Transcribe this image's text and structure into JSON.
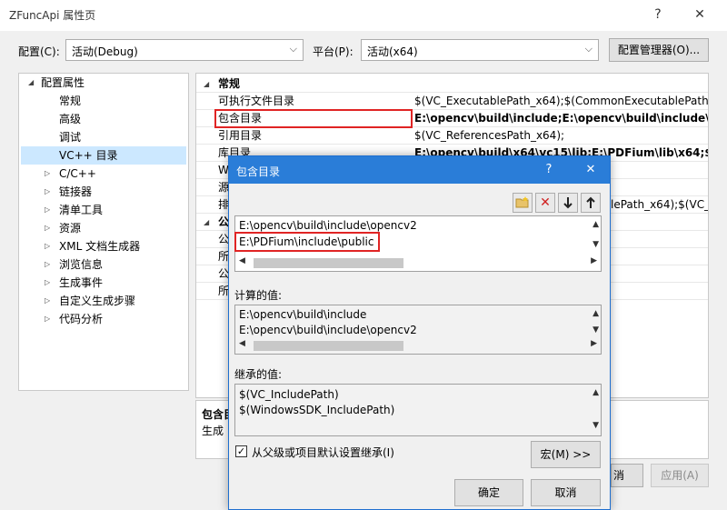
{
  "window": {
    "title": "ZFuncApi 属性页",
    "help": "?",
    "close": "✕"
  },
  "config_label": "配置(C):",
  "config_value": "活动(Debug)",
  "platform_label": "平台(P):",
  "platform_value": "活动(x64)",
  "config_manager_button": "配置管理器(O)...",
  "tree": {
    "root": "配置属性",
    "children": [
      "常规",
      "高级",
      "调试",
      "VC++ 目录"
    ],
    "collapsed": [
      "C/C++",
      "链接器",
      "清单工具",
      "资源",
      "XML 文档生成器",
      "浏览信息",
      "生成事件",
      "自定义生成步骤",
      "代码分析"
    ]
  },
  "grid": {
    "section_general": "常规",
    "rows": [
      {
        "name": "可执行文件目录",
        "value": "$(VC_ExecutablePath_x64);$(CommonExecutablePath)"
      },
      {
        "name": "包含目录",
        "value": "E:\\opencv\\build\\include;E:\\opencv\\build\\include\\ope"
      },
      {
        "name": "引用目录",
        "value": "$(VC_ReferencesPath_x64);"
      },
      {
        "name": "库目录",
        "value": "E:\\opencv\\build\\x64\\vc15\\lib;E:\\PDFium\\lib\\x64;$(Lil"
      },
      {
        "name": "W",
        "value": ""
      },
      {
        "name": "源",
        "value": ""
      },
      {
        "name": "排",
        "value": "lePath_x64);$(VC_I"
      }
    ],
    "section_public": "公",
    "public_rows": [
      "公",
      "所",
      "公",
      "所"
    ]
  },
  "description": {
    "title": "包含目",
    "text": "生成"
  },
  "buttons": {
    "cancel_partial": "消",
    "apply": "应用(A)"
  },
  "dialog": {
    "title": "包含目录",
    "help": "?",
    "close": "✕",
    "toolbar": [
      "new-folder",
      "delete",
      "move-down",
      "move-up"
    ],
    "entries": [
      "E:\\opencv\\build\\include\\opencv2",
      "E:\\PDFium\\include\\public"
    ],
    "computed_label": "计算的值:",
    "computed": [
      "E:\\opencv\\build\\include",
      "E:\\opencv\\build\\include\\opencv2"
    ],
    "inherited_label": "继承的值:",
    "inherited": [
      "$(VC_IncludePath)",
      "$(WindowsSDK_IncludePath)"
    ],
    "inherit_checkbox": "从父级或项目默认设置继承(I)",
    "inherit_checked": true,
    "macros_button": "宏(M) >>",
    "ok_button": "确定",
    "cancel_button": "取消"
  },
  "colors": {
    "accent": "#2a7dd8",
    "highlight_box": "#e02424",
    "selection": "#cce8ff"
  }
}
